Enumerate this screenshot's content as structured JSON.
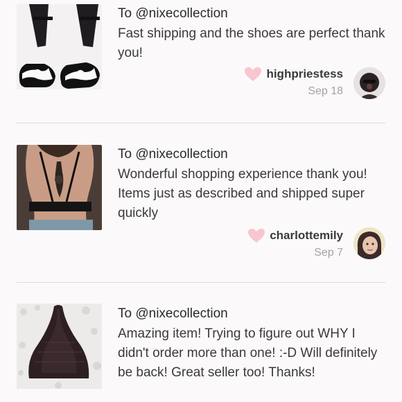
{
  "reviews": [
    {
      "to": "To @nixecollection",
      "text": "Fast shipping and the shoes are perfect thank you!",
      "username": "highpriestess",
      "date": "Sep 18",
      "thumb_icon": "shoes-photo",
      "avatar_icon": "user-avatar"
    },
    {
      "to": "To @nixecollection",
      "text": "Wonderful shopping experience thank you! Items just as described and shipped super quickly",
      "username": "charlottemily",
      "date": "Sep 7",
      "thumb_icon": "bralette-back-photo",
      "avatar_icon": "user-avatar"
    },
    {
      "to": "To @nixecollection",
      "text": "Amazing item! Trying to figure out WHY I didn't order more than one! :-D Will definitely be back! Great seller too! Thanks!",
      "thumb_icon": "lace-halter-photo"
    }
  ],
  "colors": {
    "background": "#fbf9fa",
    "heart": "#f7c6cf",
    "divider": "#dcdcdc",
    "date": "#a4a4a4"
  }
}
